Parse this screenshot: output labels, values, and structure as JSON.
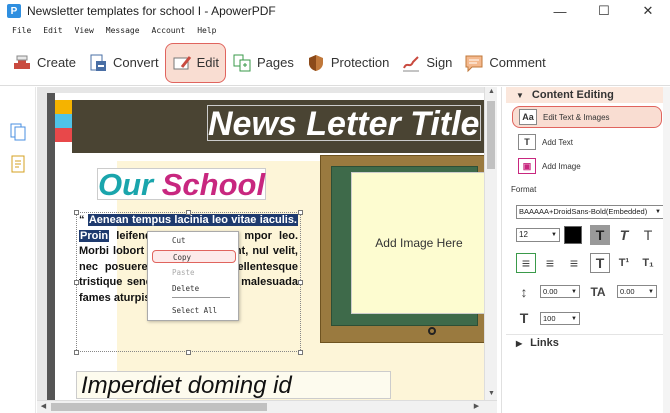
{
  "window": {
    "title": "Newsletter templates for school I - ApowerPDF",
    "app_icon": "P"
  },
  "window_controls": {
    "minimize": "—",
    "maximize": "☐",
    "close": "✕"
  },
  "menu": [
    "File",
    "Edit",
    "View",
    "Message",
    "Account",
    "Help"
  ],
  "toolbar": [
    {
      "label": "Create",
      "icon": "create-icon"
    },
    {
      "label": "Convert",
      "icon": "convert-icon"
    },
    {
      "label": "Edit",
      "icon": "edit-icon",
      "active": true
    },
    {
      "label": "Pages",
      "icon": "pages-icon"
    },
    {
      "label": "Protection",
      "icon": "shield-icon"
    },
    {
      "label": "Sign",
      "icon": "sign-icon"
    },
    {
      "label": "Comment",
      "icon": "comment-icon"
    }
  ],
  "document": {
    "banner_title": "News Letter Title",
    "school_title_1": "Our",
    "school_title_2": "School",
    "body_quote_open": "“",
    "body_highlight_1": "Aenean tempus lacinia leo vitae iaculis.",
    "body_highlight_2": "Proin",
    "body_rest_1": "leifend in suscipit at,",
    "body_rest_2": "mpor leo. Morbi lobort",
    "body_rest_3": "tincidunt tincidunt, nul",
    "body_rest_4": "velit, nec posuere ris",
    "body_rest_5": "get velit. Pellentesque",
    "body_rest_6": "tristique senectus et netus et malesuada fames aturpis egestas. ”",
    "add_image": "Add Image Here",
    "subheading": "Imperdiet doming id"
  },
  "context_menu": {
    "items": [
      {
        "label": "Cut",
        "disabled": false
      },
      {
        "label": "Copy",
        "disabled": false,
        "selected": true
      },
      {
        "label": "Paste",
        "disabled": true
      },
      {
        "label": "Delete",
        "disabled": false
      },
      {
        "label": "Select All",
        "disabled": false
      }
    ]
  },
  "right_panel": {
    "content_editing": "Content Editing",
    "edit_text_images": "Edit Text & Images",
    "add_text": "Add Text",
    "add_image": "Add Image",
    "format": "Format",
    "font": "BAAAAA+DroidSans-Bold(Embedded)",
    "font_size": "12",
    "color": "#000000",
    "line_spacing": "0.00",
    "char_spacing": "0.00",
    "scale": "100",
    "links": "Links"
  },
  "colors": {
    "accent": "#e0645e",
    "highlight": "#1e3a6e",
    "teal": "#1aa5ac",
    "magenta": "#c8277f"
  }
}
